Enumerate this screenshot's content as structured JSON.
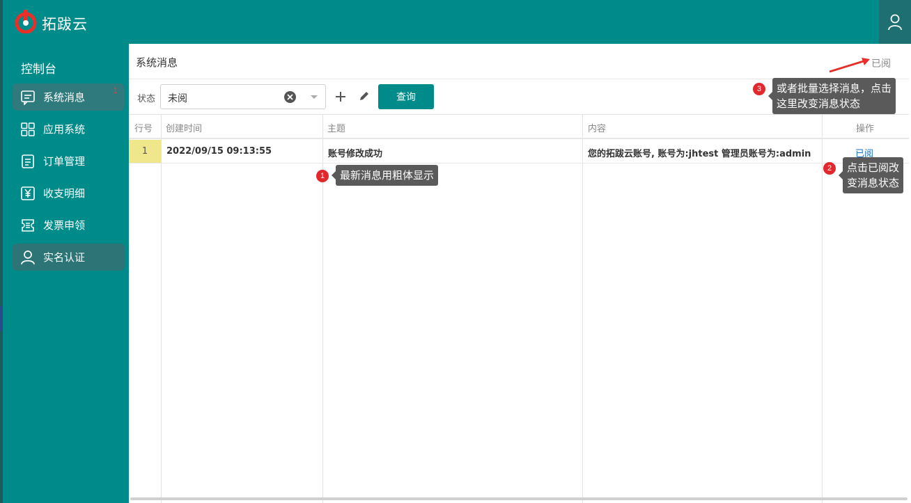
{
  "app": {
    "brand": "拓跋云"
  },
  "sidebar": {
    "title": "控制台",
    "items": [
      {
        "label": "系统消息",
        "icon": "message-icon",
        "badge": "1"
      },
      {
        "label": "应用系统",
        "icon": "apps-grid-icon"
      },
      {
        "label": "订单管理",
        "icon": "order-doc-icon"
      },
      {
        "label": "收支明细",
        "icon": "yen-icon"
      },
      {
        "label": "发票申领",
        "icon": "invoice-icon"
      },
      {
        "label": "实名认证",
        "icon": "user-icon"
      }
    ]
  },
  "page": {
    "title": "系统消息",
    "read_action": "已阅"
  },
  "toolbar": {
    "status_label": "状态",
    "status_value": "未阅",
    "query_label": "查询"
  },
  "table": {
    "headers": [
      "行号",
      "创建时间",
      "主题",
      "内容",
      "操作"
    ],
    "rows": [
      {
        "num": "1",
        "created": "2022/09/15 09:13:55",
        "subject": "账号修改成功",
        "content": "您的拓跋云账号, 账号为:jhtest 管理员账号为:admin",
        "action": "已阅"
      }
    ]
  },
  "callouts": [
    {
      "num": "1",
      "text": "最新消息用粗体显示"
    },
    {
      "num": "2",
      "line1": "点击已阅改",
      "line2": "变消息状态"
    },
    {
      "num": "3",
      "line1": "或者批量选择消息，点击",
      "line2": "这里改变消息状态"
    }
  ],
  "colors": {
    "primary": "#008b8b",
    "badge": "#e3282d",
    "link": "#1a6fc4"
  }
}
